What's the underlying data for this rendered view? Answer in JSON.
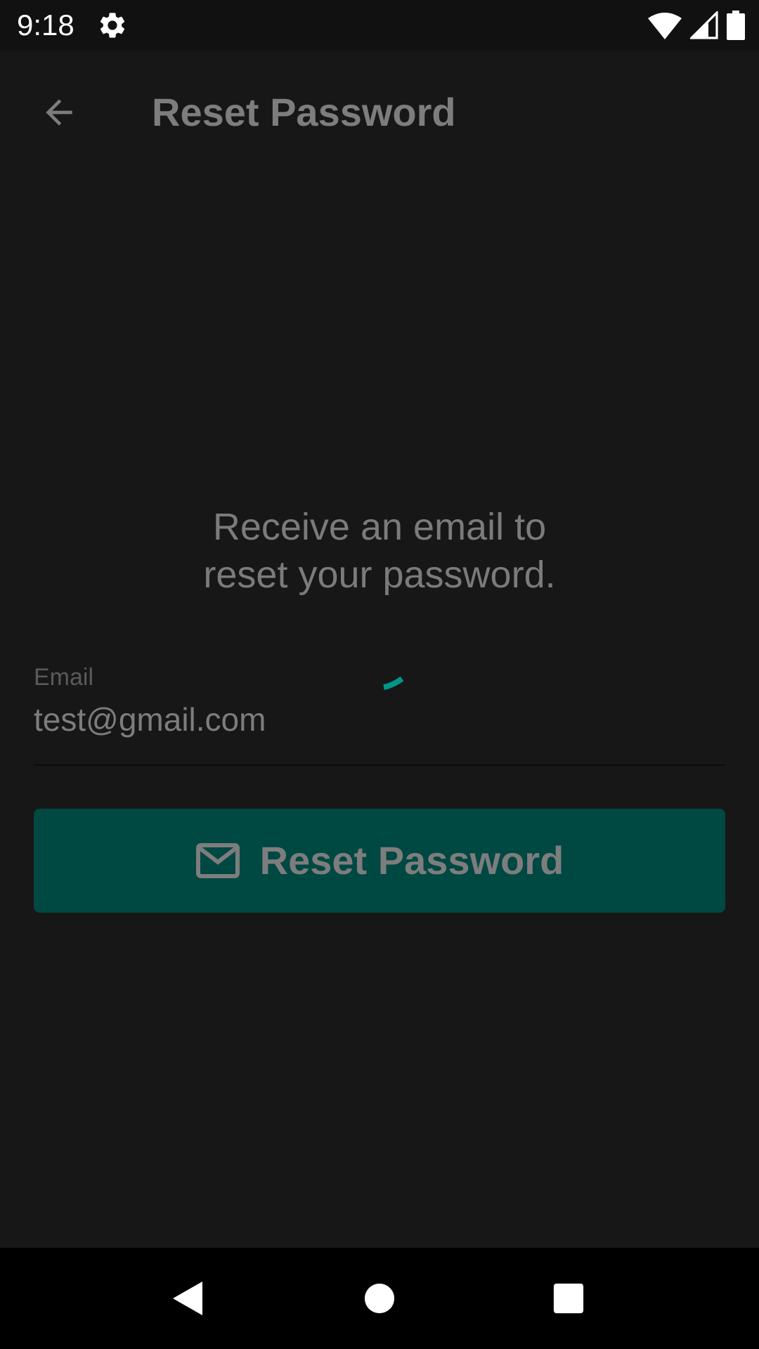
{
  "status_bar": {
    "time": "9:18",
    "icons": [
      "gear-icon",
      "wifi-icon",
      "signal-icon",
      "battery-icon"
    ]
  },
  "app_bar": {
    "title": "Reset Password",
    "back_icon": "arrow-left-icon"
  },
  "main": {
    "subtitle_line1": "Receive an email to",
    "subtitle_line2": "reset your password.",
    "email_field": {
      "label": "Email",
      "value": "test@gmail.com"
    },
    "reset_button": {
      "label": "Reset Password",
      "icon": "mail-icon"
    }
  },
  "nav_bar": {
    "items": [
      "back-triangle-icon",
      "home-circle-icon",
      "recents-square-icon"
    ]
  },
  "colors": {
    "background": "#171717",
    "accent": "#004842",
    "spinner": "#009688",
    "text_dim": "#7d7d7d"
  }
}
